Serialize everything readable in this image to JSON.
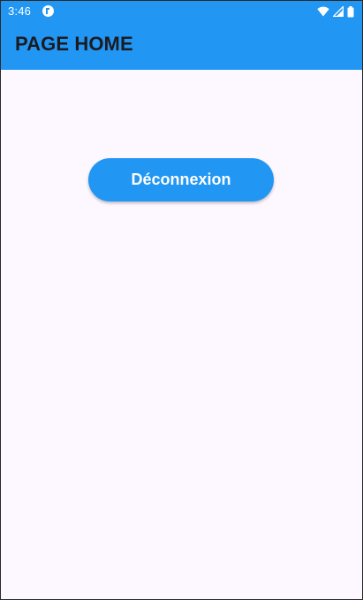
{
  "status_bar": {
    "time": "3:46",
    "icons": [
      "notification-icon",
      "wifi-icon",
      "signal-icon",
      "battery-icon"
    ]
  },
  "app_bar": {
    "title": "PAGE HOME",
    "background_color": "#2196f3",
    "title_color": "#1b1b22"
  },
  "main": {
    "background_color": "#fdf7ff",
    "logout_button": {
      "label": "Déconnexion",
      "background_color": "#2196f3",
      "text_color": "#ffffff"
    }
  }
}
